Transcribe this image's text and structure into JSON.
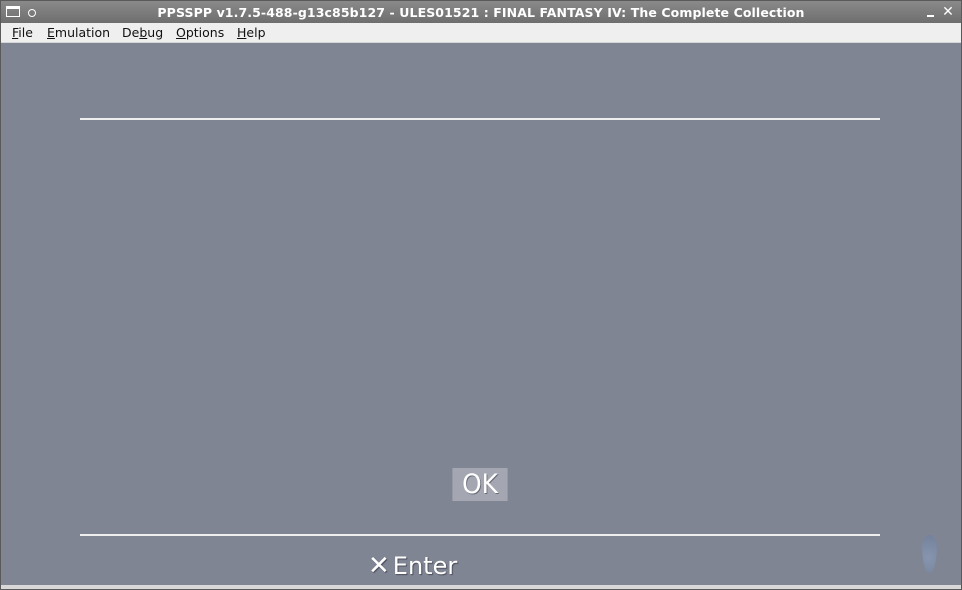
{
  "window": {
    "title": "PPSSPP v1.7.5-488-g13c85b127 - ULES01521 : FINAL FANTASY IV: The Complete Collection",
    "close_glyph": "✕"
  },
  "menubar": {
    "file": {
      "mnemonic": "F",
      "rest": "ile"
    },
    "emulation": {
      "mnemonic": "E",
      "rest": "mulation"
    },
    "debug": {
      "pre": "De",
      "mnemonic": "b",
      "rest": "ug"
    },
    "options": {
      "mnemonic": "O",
      "rest": "ptions"
    },
    "help": {
      "mnemonic": "H",
      "rest": "elp"
    }
  },
  "game": {
    "ok_label": "OK",
    "enter_icon": "✕",
    "enter_label": "Enter",
    "background_color": "#808594",
    "line_color": "#eeeeee"
  },
  "icons": {
    "system_menu": "window-menu-icon",
    "sticky": "sticky-icon",
    "minimize": "minimize-icon",
    "close": "close-icon",
    "cross_button": "cross-button-icon",
    "drop": "water-drop-icon"
  }
}
